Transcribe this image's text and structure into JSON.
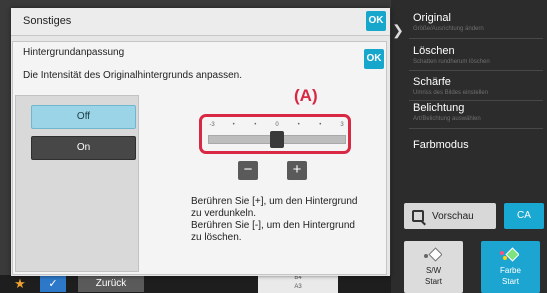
{
  "right_menu": {
    "items": [
      {
        "title": "Original",
        "subtitle": "Größe/Ausrichtung ändern"
      },
      {
        "title": "Löschen",
        "subtitle": "Schatten rundherum löschen"
      },
      {
        "title": "Schärfe",
        "subtitle": "Umriss des Bildes einstellen"
      },
      {
        "title": "Belichtung",
        "subtitle": "Art/Belichtung auswählen"
      },
      {
        "title": "Farbmodus",
        "subtitle": ""
      }
    ],
    "preview_label": "Vorschau",
    "ca_label": "CA",
    "start_bw": {
      "line1": "S/W",
      "line2": "Start"
    },
    "start_color": {
      "line1": "Farbe",
      "line2": "Start"
    },
    "accent_color": "#1da5d2"
  },
  "bottom_bar": {
    "back_label": "Zurück",
    "paper_size_top": "B4",
    "paper_size_bottom": "A3"
  },
  "outer_dialog": {
    "title": "Sonstiges",
    "ok_label": "OK"
  },
  "inner_dialog": {
    "title": "Hintergrundanpassung",
    "ok_label": "OK",
    "description": "Die Intensität des Originalhintergrunds anpassen.",
    "options": {
      "off_label": "Off",
      "on_label": "On",
      "selected": "Off"
    },
    "slider": {
      "ticks": [
        "-3",
        "•",
        "•",
        "0",
        "•",
        "•",
        "3"
      ],
      "min": -3,
      "max": 3,
      "value": 0
    },
    "callout_label": "(A)",
    "minus_label": "−",
    "plus_label": "+",
    "help_line1": "Berühren Sie [+], um den Hintergrund",
    "help_line2": "zu verdunkeln.",
    "help_line3": "Berühren Sie [-], um den Hintergrund",
    "help_line4": "zu löschen."
  }
}
